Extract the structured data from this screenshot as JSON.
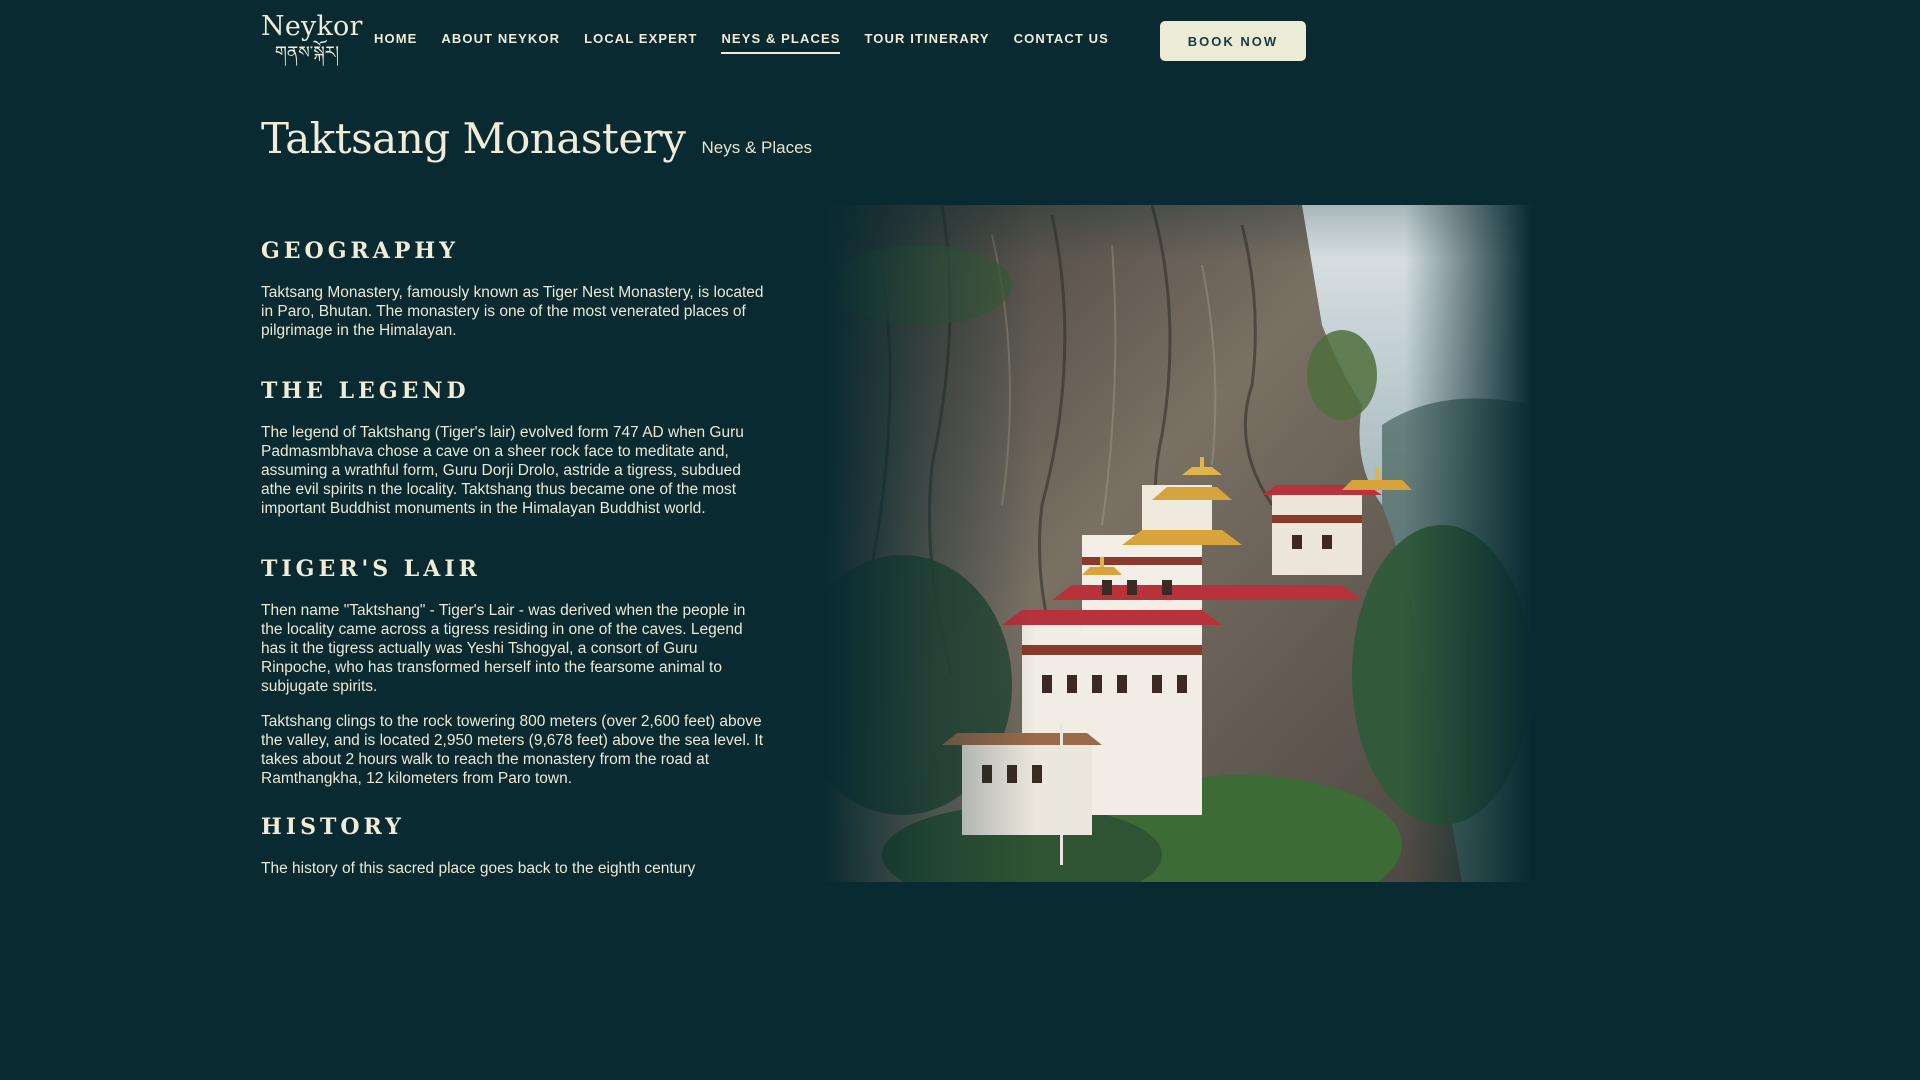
{
  "brand": {
    "name": "Neykor",
    "script": "གནས་སྐོར།"
  },
  "nav": {
    "items": [
      {
        "label": "HOME"
      },
      {
        "label": "ABOUT NEYKOR"
      },
      {
        "label": "LOCAL EXPERT"
      },
      {
        "label": "NEYS & PLACES",
        "active": true
      },
      {
        "label": "TOUR ITINERARY"
      },
      {
        "label": "CONTACT US"
      }
    ],
    "cta": "BOOK NOW"
  },
  "page": {
    "title": "Taktsang Monastery",
    "category": "Neys & Places"
  },
  "sections": [
    {
      "heading": "GEOGRAPHY",
      "paragraphs": [
        "Taktsang Monastery, famously known as Tiger Nest Monastery, is located in Paro, Bhutan. The monastery is one of the most venerated places of pilgrimage in the Himalayan."
      ]
    },
    {
      "heading": "THE LEGEND",
      "paragraphs": [
        "The legend of Taktshang (Tiger's lair) evolved form 747 AD when Guru Padmasmbhava chose a cave on a sheer rock face to meditate and, assuming a wrathful form, Guru Dorji Drolo, astride a tigress, subdued athe evil spirits n the locality. Taktshang thus became one of the most important Buddhist monuments in the Himalayan Buddhist world."
      ]
    },
    {
      "heading": "TIGER'S LAIR",
      "paragraphs": [
        "Then name \"Taktshang\" - Tiger's Lair - was derived when the people in the locality came across a tigress residing in one of the caves. Legend has it the tigress actually was Yeshi Tshogyal, a consort of Guru Rinpoche, who has transformed herself into the fearsome animal to subjugate spirits.",
        "Taktshang clings to the rock towering 800 meters (over 2,600 feet) above the valley, and is located 2,950 meters (9,678 feet) above the sea level. It takes about 2 hours walk to reach the monastery from the road at Ramthangkha, 12 kilometers from Paro town."
      ]
    },
    {
      "heading": "HISTORY",
      "paragraphs": [
        "The history of this sacred place goes back to the eighth century"
      ]
    }
  ],
  "colors": {
    "background": "#082a30",
    "text": "#f1ecd8",
    "button_bg": "#ecebd5",
    "button_text": "#163a44",
    "roof_red": "#b8323c",
    "gold": "#d6a43a"
  },
  "image": {
    "icon": "monastery-cliff-photo"
  }
}
